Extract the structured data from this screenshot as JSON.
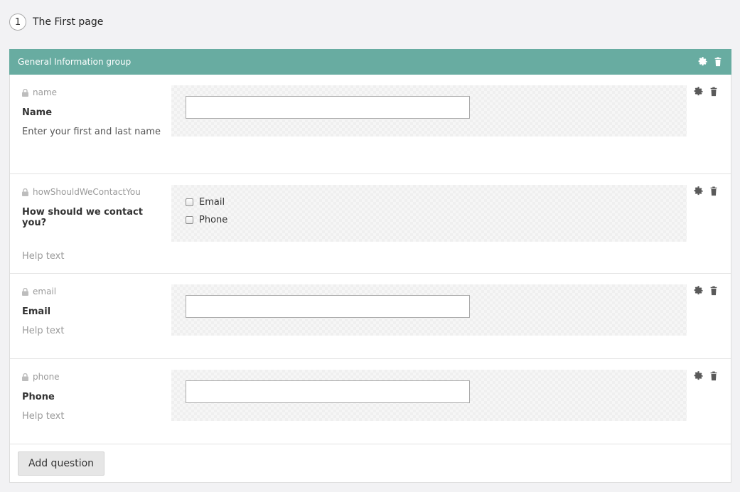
{
  "page": {
    "number": "1",
    "title": "The First page"
  },
  "group": {
    "title": "General Information group",
    "icons": [
      "gear-icon",
      "trash-icon"
    ]
  },
  "questions": [
    {
      "key": "name",
      "label": "Name",
      "help": "Enter your first and last name",
      "type": "text"
    },
    {
      "key": "howShouldWeContactYou",
      "label": "How should we contact you?",
      "help": "Help text",
      "type": "checkbox",
      "options": [
        "Email",
        "Phone"
      ]
    },
    {
      "key": "email",
      "label": "Email",
      "help": "Help text",
      "type": "text"
    },
    {
      "key": "phone",
      "label": "Phone",
      "help": "Help text",
      "type": "text"
    }
  ],
  "footer": {
    "add_question_label": "Add question"
  },
  "colors": {
    "group_header": "#68aca1",
    "background": "#f2f2f4"
  }
}
